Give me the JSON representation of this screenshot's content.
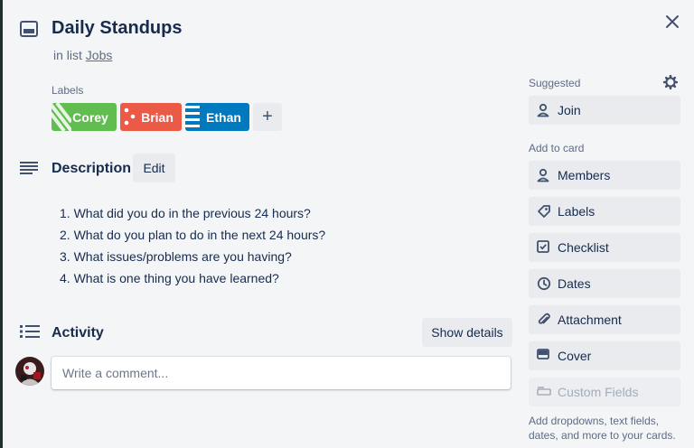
{
  "card": {
    "title": "Daily Standups",
    "in_list_prefix": "in list",
    "list_name": "Jobs"
  },
  "labels": {
    "heading": "Labels",
    "items": [
      {
        "name": "Corey",
        "color": "#61bd4f"
      },
      {
        "name": "Brian",
        "color": "#eb5a46"
      },
      {
        "name": "Ethan",
        "color": "#0079bf"
      }
    ],
    "add_symbol": "+"
  },
  "description": {
    "heading": "Description",
    "edit_label": "Edit",
    "items": [
      "1. What did you do in the previous 24 hours?",
      "2. What do you plan to do in the next 24 hours?",
      "3. What issues/problems are you having?",
      "4. What is one thing you have learned?"
    ]
  },
  "activity": {
    "heading": "Activity",
    "show_details_label": "Show details",
    "comment_placeholder": "Write a comment..."
  },
  "sidebar": {
    "suggested_heading": "Suggested",
    "join_label": "Join",
    "add_to_card_heading": "Add to card",
    "actions": [
      {
        "label": "Members",
        "icon": "person-icon"
      },
      {
        "label": "Labels",
        "icon": "tag-icon"
      },
      {
        "label": "Checklist",
        "icon": "checklist-icon"
      },
      {
        "label": "Dates",
        "icon": "clock-icon"
      },
      {
        "label": "Attachment",
        "icon": "paperclip-icon"
      },
      {
        "label": "Cover",
        "icon": "cover-icon"
      },
      {
        "label": "Custom Fields",
        "icon": "custom-fields-icon",
        "disabled": true
      }
    ],
    "custom_fields_note": "Add dropdowns, text fields, dates, and more to your cards."
  }
}
